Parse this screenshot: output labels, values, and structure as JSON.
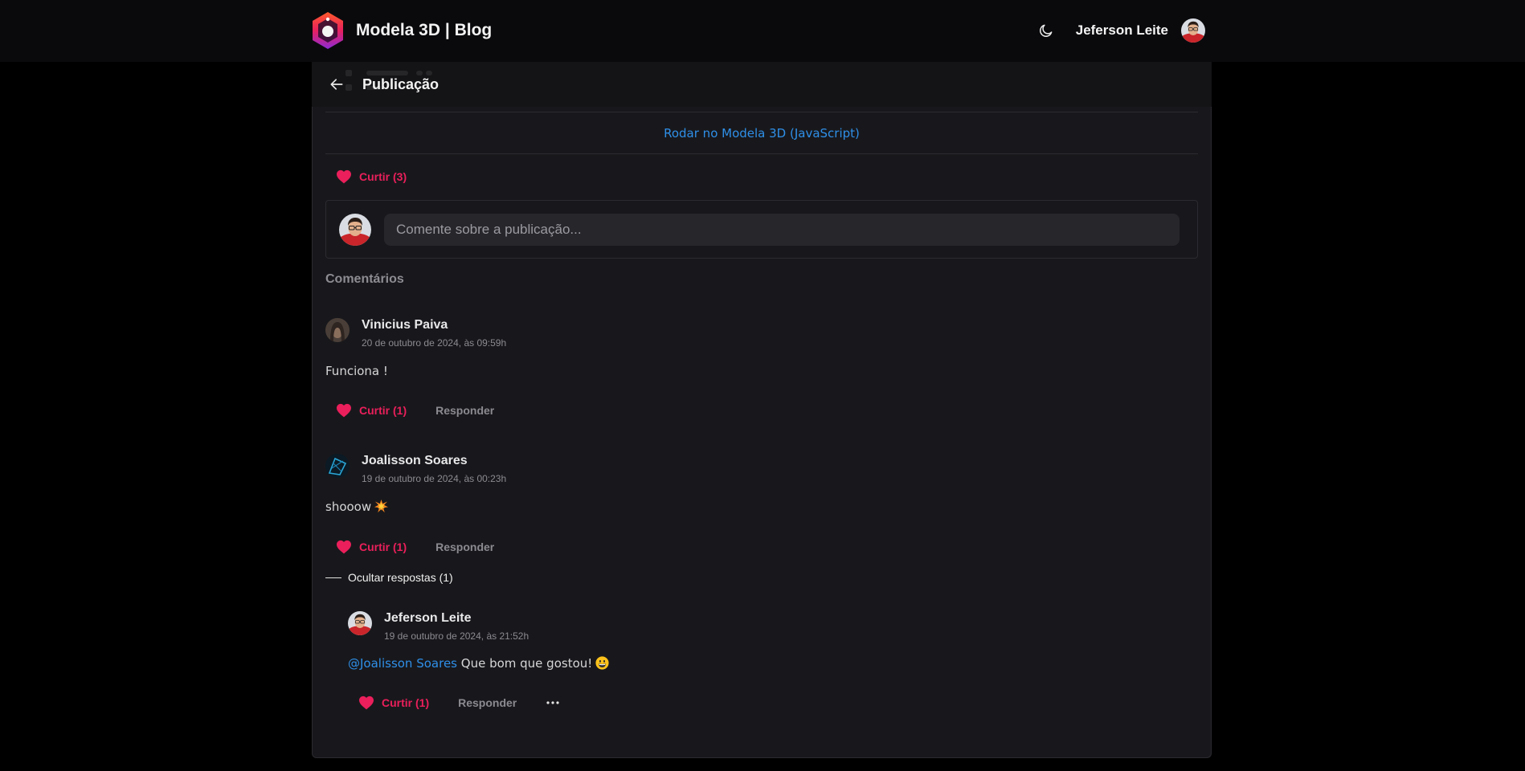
{
  "app": {
    "title": "Modela 3D | Blog"
  },
  "header": {
    "user_name": "Jeferson Leite",
    "theme_icon": "moon-icon"
  },
  "page": {
    "title": "Publicação"
  },
  "post": {
    "run_link": "Rodar no Modela 3D (JavaScript)",
    "like_label": "Curtir (3)"
  },
  "comment_box": {
    "placeholder": "Comente sobre a publicação..."
  },
  "comments_section": {
    "title": "Comentários"
  },
  "comments": [
    {
      "author": "Vinicius Paiva",
      "date": "20 de outubro de 2024, às 09:59h",
      "text": "Funciona !",
      "like_label": "Curtir (1)",
      "reply_label": "Responder"
    },
    {
      "author": "Joalisson Soares",
      "date": "19 de outubro de 2024, às 00:23h",
      "text": "shooow",
      "emoji": "collision",
      "like_label": "Curtir (1)",
      "reply_label": "Responder",
      "toggle_replies_label": "Ocultar respostas (1)",
      "replies": [
        {
          "author": "Jeferson Leite",
          "date": "19 de outubro de 2024, às 21:52h",
          "mention": "@Joalisson Soares",
          "text": "Que bom que gostou!",
          "emoji": "grinning-face",
          "like_label": "Curtir (1)",
          "reply_label": "Responder"
        }
      ]
    }
  ],
  "colors": {
    "background": "#000000",
    "card": "#18181c",
    "accent_like": "#ea1f5b",
    "link": "#2f8fe8"
  }
}
